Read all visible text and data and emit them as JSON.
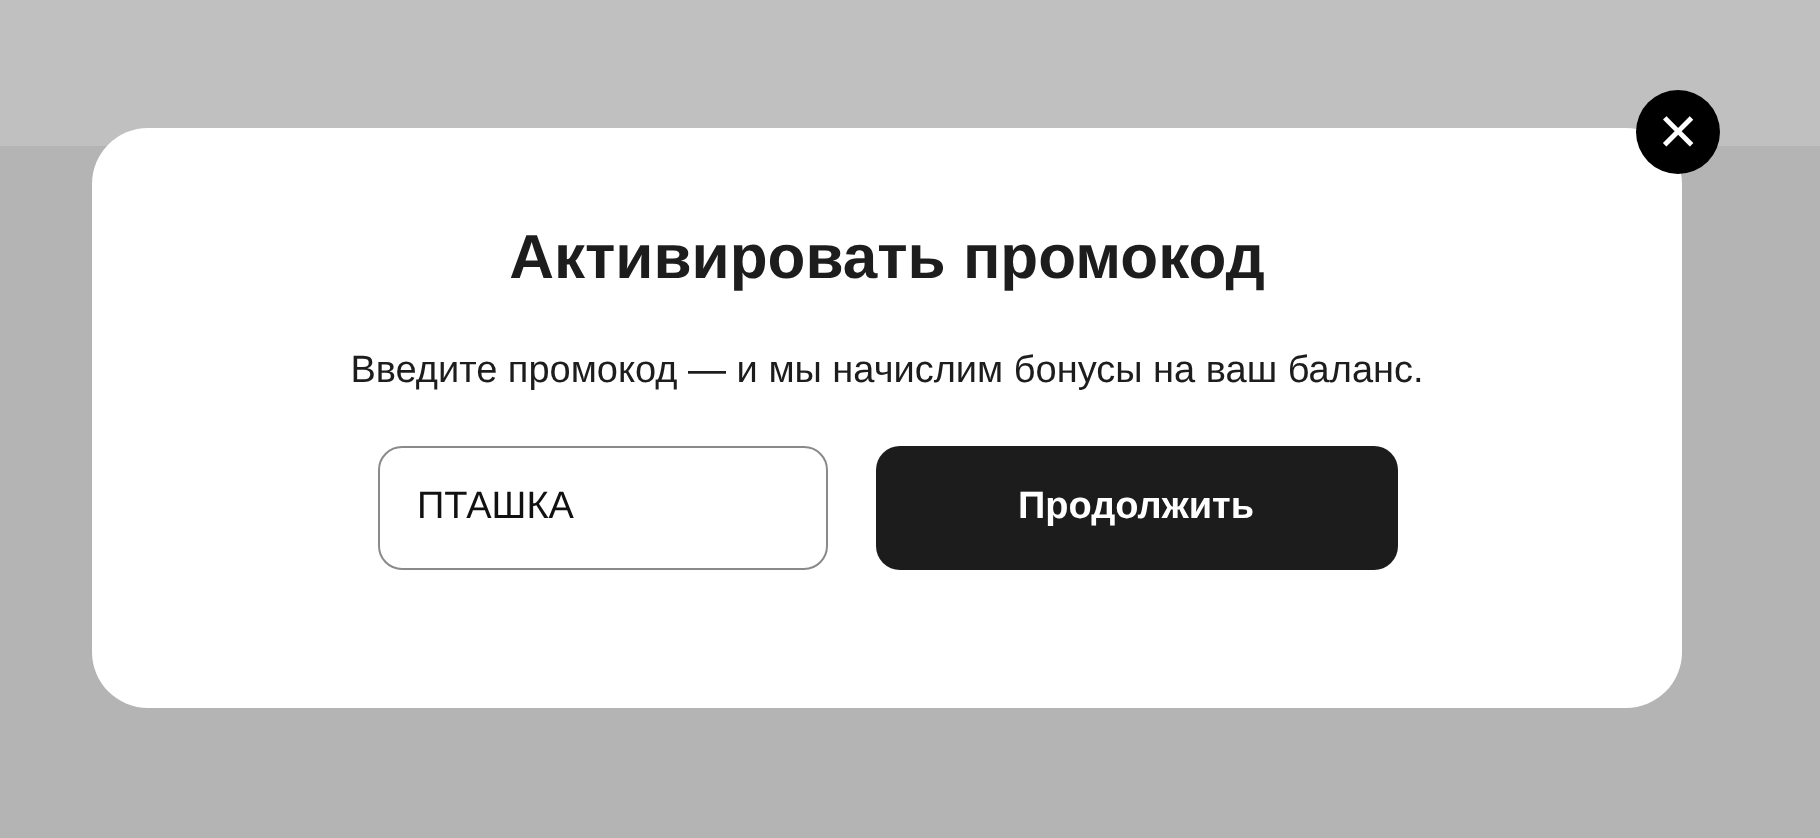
{
  "dialog": {
    "title": "Активировать промокод",
    "description": "Введите промокод — и мы начислим бонусы на ваш баланс.",
    "promo_field": {
      "value": "ПТАШКА"
    },
    "submit_button": "Продолжить",
    "close_button": "×"
  }
}
